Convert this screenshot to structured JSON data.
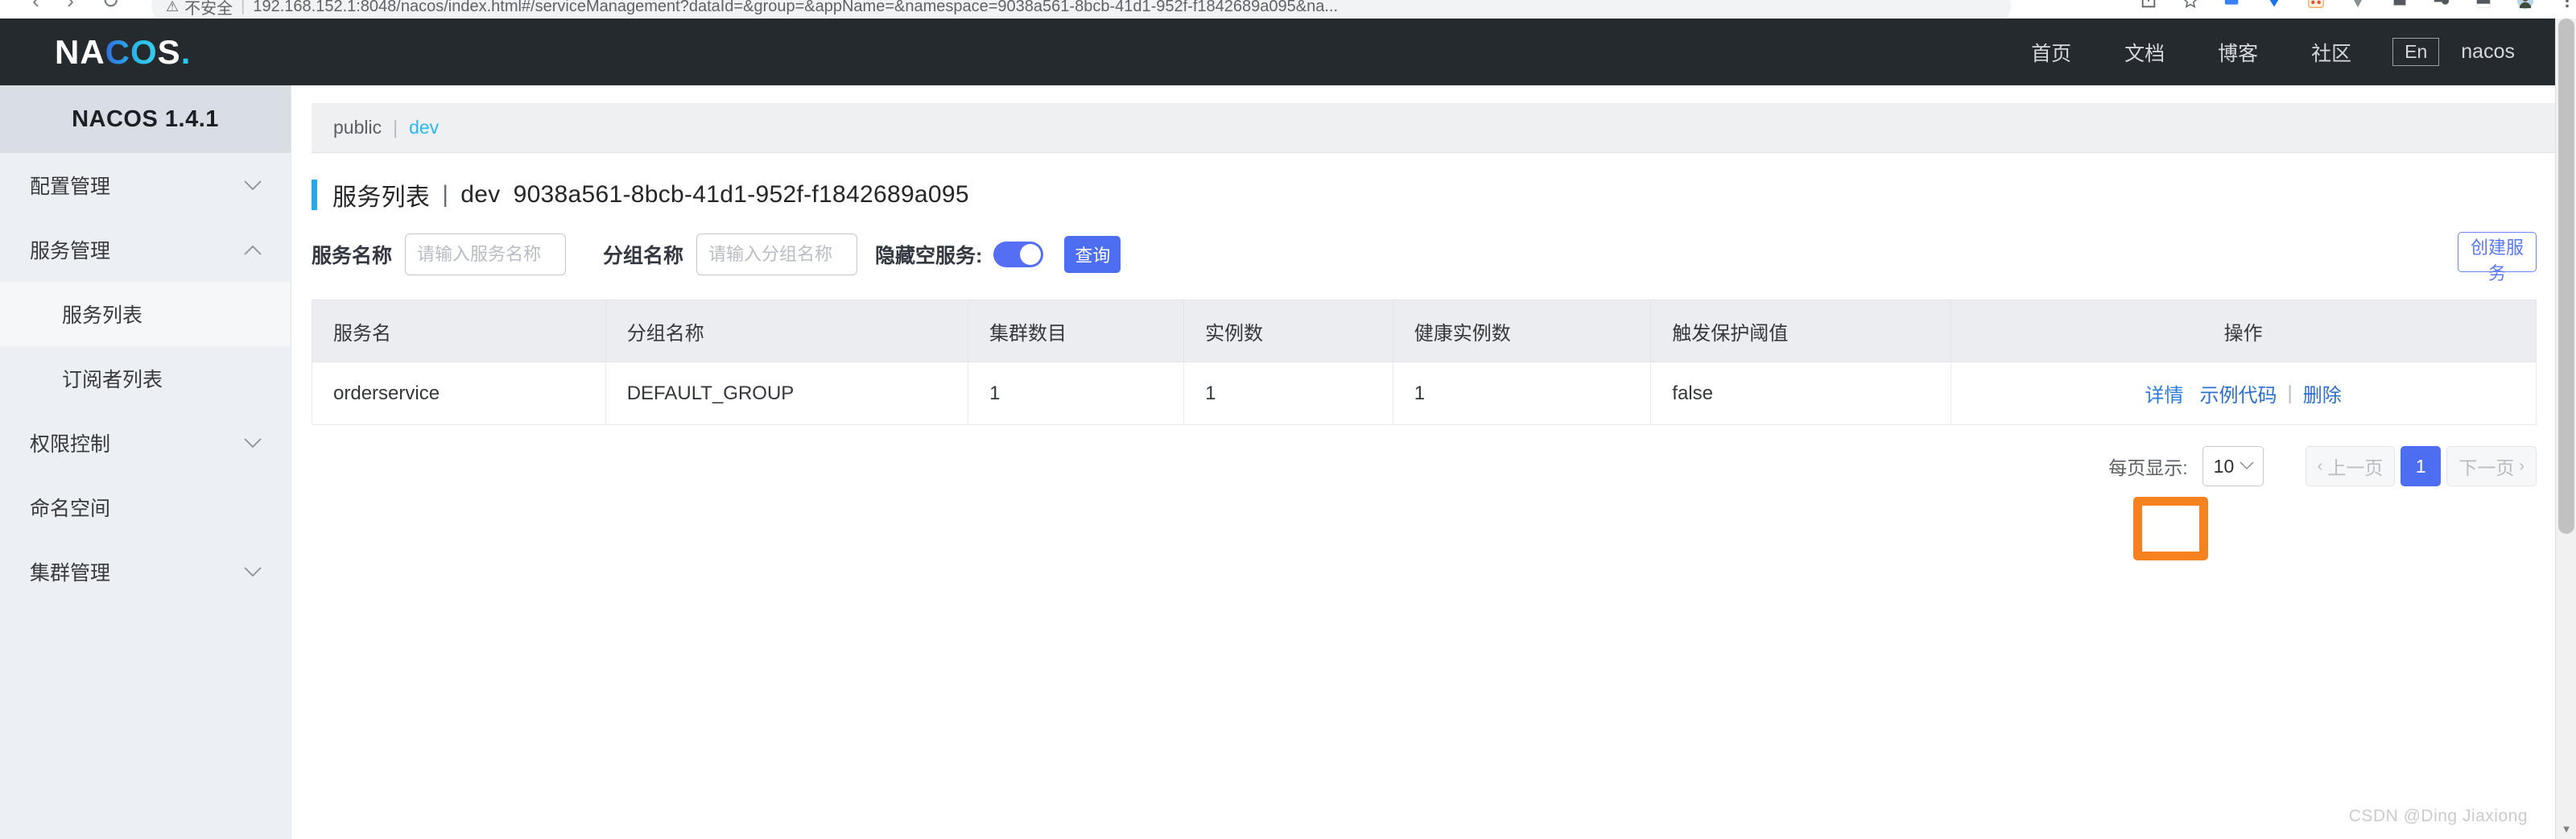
{
  "browser": {
    "back_icon": "back-arrow-icon",
    "forward_icon": "forward-arrow-icon",
    "reload_icon": "reload-icon",
    "security_badge": "不安全",
    "url": "192.168.152.1:8048/nacos/index.html#/serviceManagement?dataId=&group=&appName=&namespace=9038a561-8bcb-41d1-952f-f1842689a095&na...",
    "share_icon": "share-icon",
    "bookmark_icon": "bookmark-star-icon",
    "menu_icon": "three-dot-menu-icon"
  },
  "header": {
    "logo": {
      "part1": "NA",
      "part2": "CO",
      "part3": "S",
      "dot": "."
    },
    "nav": [
      {
        "label": "首页",
        "name": "nav-home"
      },
      {
        "label": "文档",
        "name": "nav-docs"
      },
      {
        "label": "博客",
        "name": "nav-blog"
      },
      {
        "label": "社区",
        "name": "nav-community"
      }
    ],
    "language_button": "En",
    "user": "nacos"
  },
  "sidebar": {
    "title": "NACOS 1.4.1",
    "items": [
      {
        "label": "配置管理",
        "type": "group",
        "expanded": false
      },
      {
        "label": "服务管理",
        "type": "group",
        "expanded": true
      },
      {
        "label": "服务列表",
        "type": "sub",
        "active": true
      },
      {
        "label": "订阅者列表",
        "type": "sub",
        "active": false
      },
      {
        "label": "权限控制",
        "type": "group",
        "expanded": false
      },
      {
        "label": "命名空间",
        "type": "item"
      },
      {
        "label": "集群管理",
        "type": "group",
        "expanded": false
      }
    ]
  },
  "breadcrumb": {
    "root": "public",
    "separator": "|",
    "current": "dev"
  },
  "page": {
    "title_main": "服务列表",
    "title_sep": "|",
    "title_namespace": "dev",
    "title_namespace_id": "9038a561-8bcb-41d1-952f-f1842689a095"
  },
  "filters": {
    "service_label": "服务名称",
    "service_placeholder": "请输入服务名称",
    "service_value": "",
    "group_label": "分组名称",
    "group_placeholder": "请输入分组名称",
    "group_value": "",
    "hide_empty_label": "隐藏空服务:",
    "hide_empty_on": true,
    "query_button": "查询",
    "create_button": "创建服务"
  },
  "table": {
    "columns": [
      {
        "label": "服务名",
        "align": "left"
      },
      {
        "label": "分组名称",
        "align": "left"
      },
      {
        "label": "集群数目",
        "align": "left"
      },
      {
        "label": "实例数",
        "align": "left"
      },
      {
        "label": "健康实例数",
        "align": "left"
      },
      {
        "label": "触发保护阈值",
        "align": "left"
      },
      {
        "label": "操作",
        "align": "center"
      }
    ],
    "rows": [
      {
        "service_name": "orderservice",
        "group_name": "DEFAULT_GROUP",
        "cluster_count": "1",
        "instance_count": "1",
        "healthy_instance_count": "1",
        "protect_threshold": "false",
        "actions": {
          "detail": "详情",
          "sample_code": "示例代码",
          "separator": "|",
          "delete": "删除"
        }
      }
    ]
  },
  "pagination": {
    "page_size_label": "每页显示:",
    "page_size_value": "10",
    "prev_label": "上一页",
    "prev_arrow": "‹",
    "current_page": "1",
    "next_label": "下一页",
    "next_arrow": "›"
  },
  "annotation": {
    "highlight_color": "#f6821f",
    "target": "详情"
  },
  "watermark": "CSDN @Ding Jiaxiong"
}
